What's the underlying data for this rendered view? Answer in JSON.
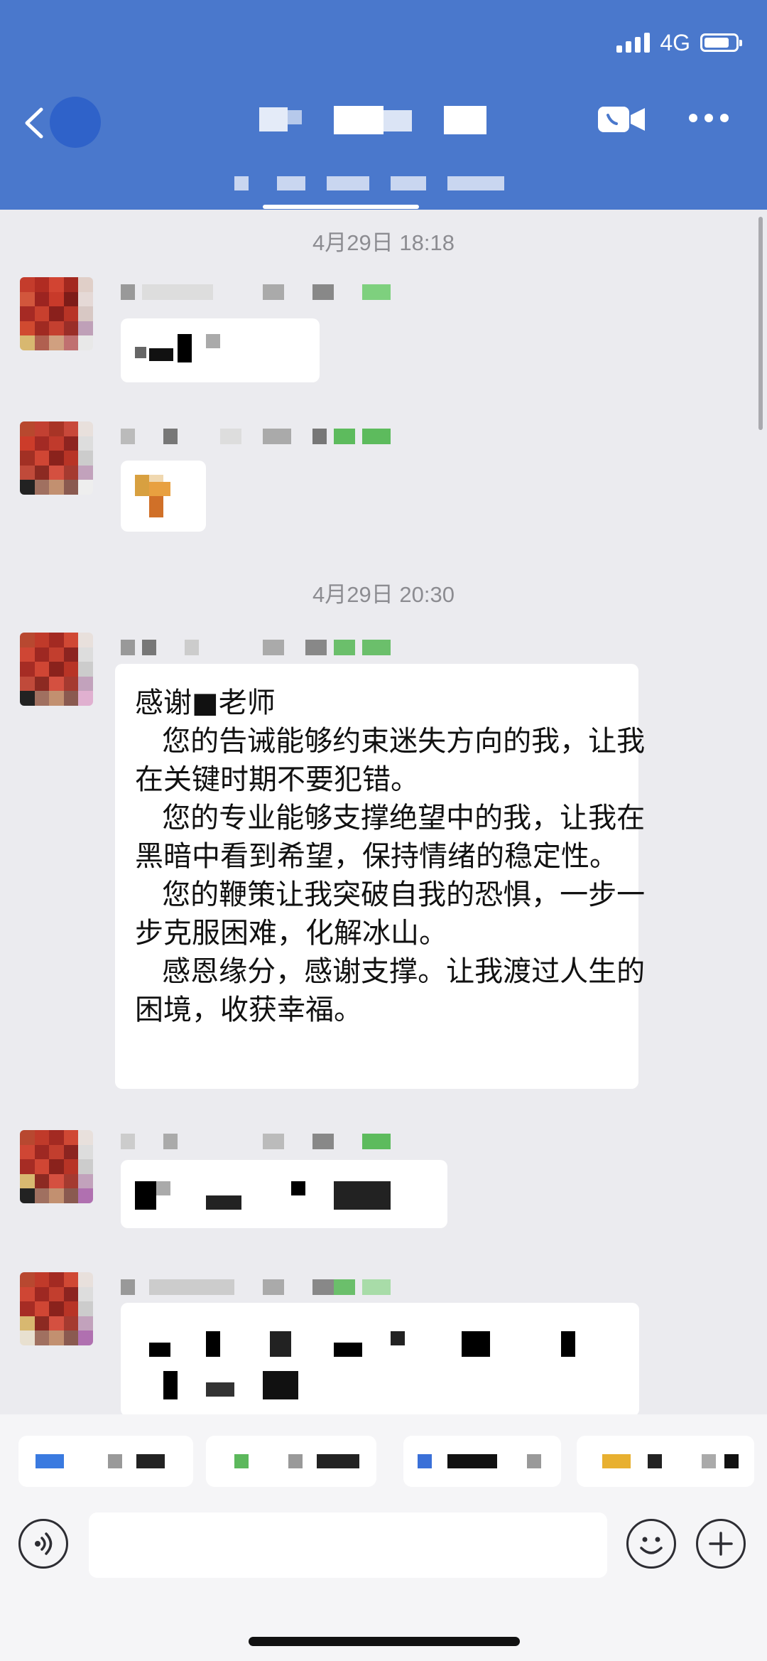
{
  "status_bar": {
    "network": "4G"
  },
  "chat": {
    "messages": [
      {
        "timestamp": "4月29日 18:18"
      },
      {
        "timestamp": "4月29日 20:30"
      }
    ],
    "long_message": "感谢■老师\n   您的告诫能够约束迷失方向的我，让我在关键时期不要犯错。\n   您的专业能够支撑绝望中的我，让我在黑暗中看到希望，保持情绪的稳定性。\n   您的鞭策让我突破自我的恐惧，一步一步克服困难，化解冰山。\n   感恩缘分，感谢支撑。让我渡过人生的困境，收获幸福。"
  },
  "colors": {
    "header": "#4a78cc",
    "background": "#ebebef"
  }
}
